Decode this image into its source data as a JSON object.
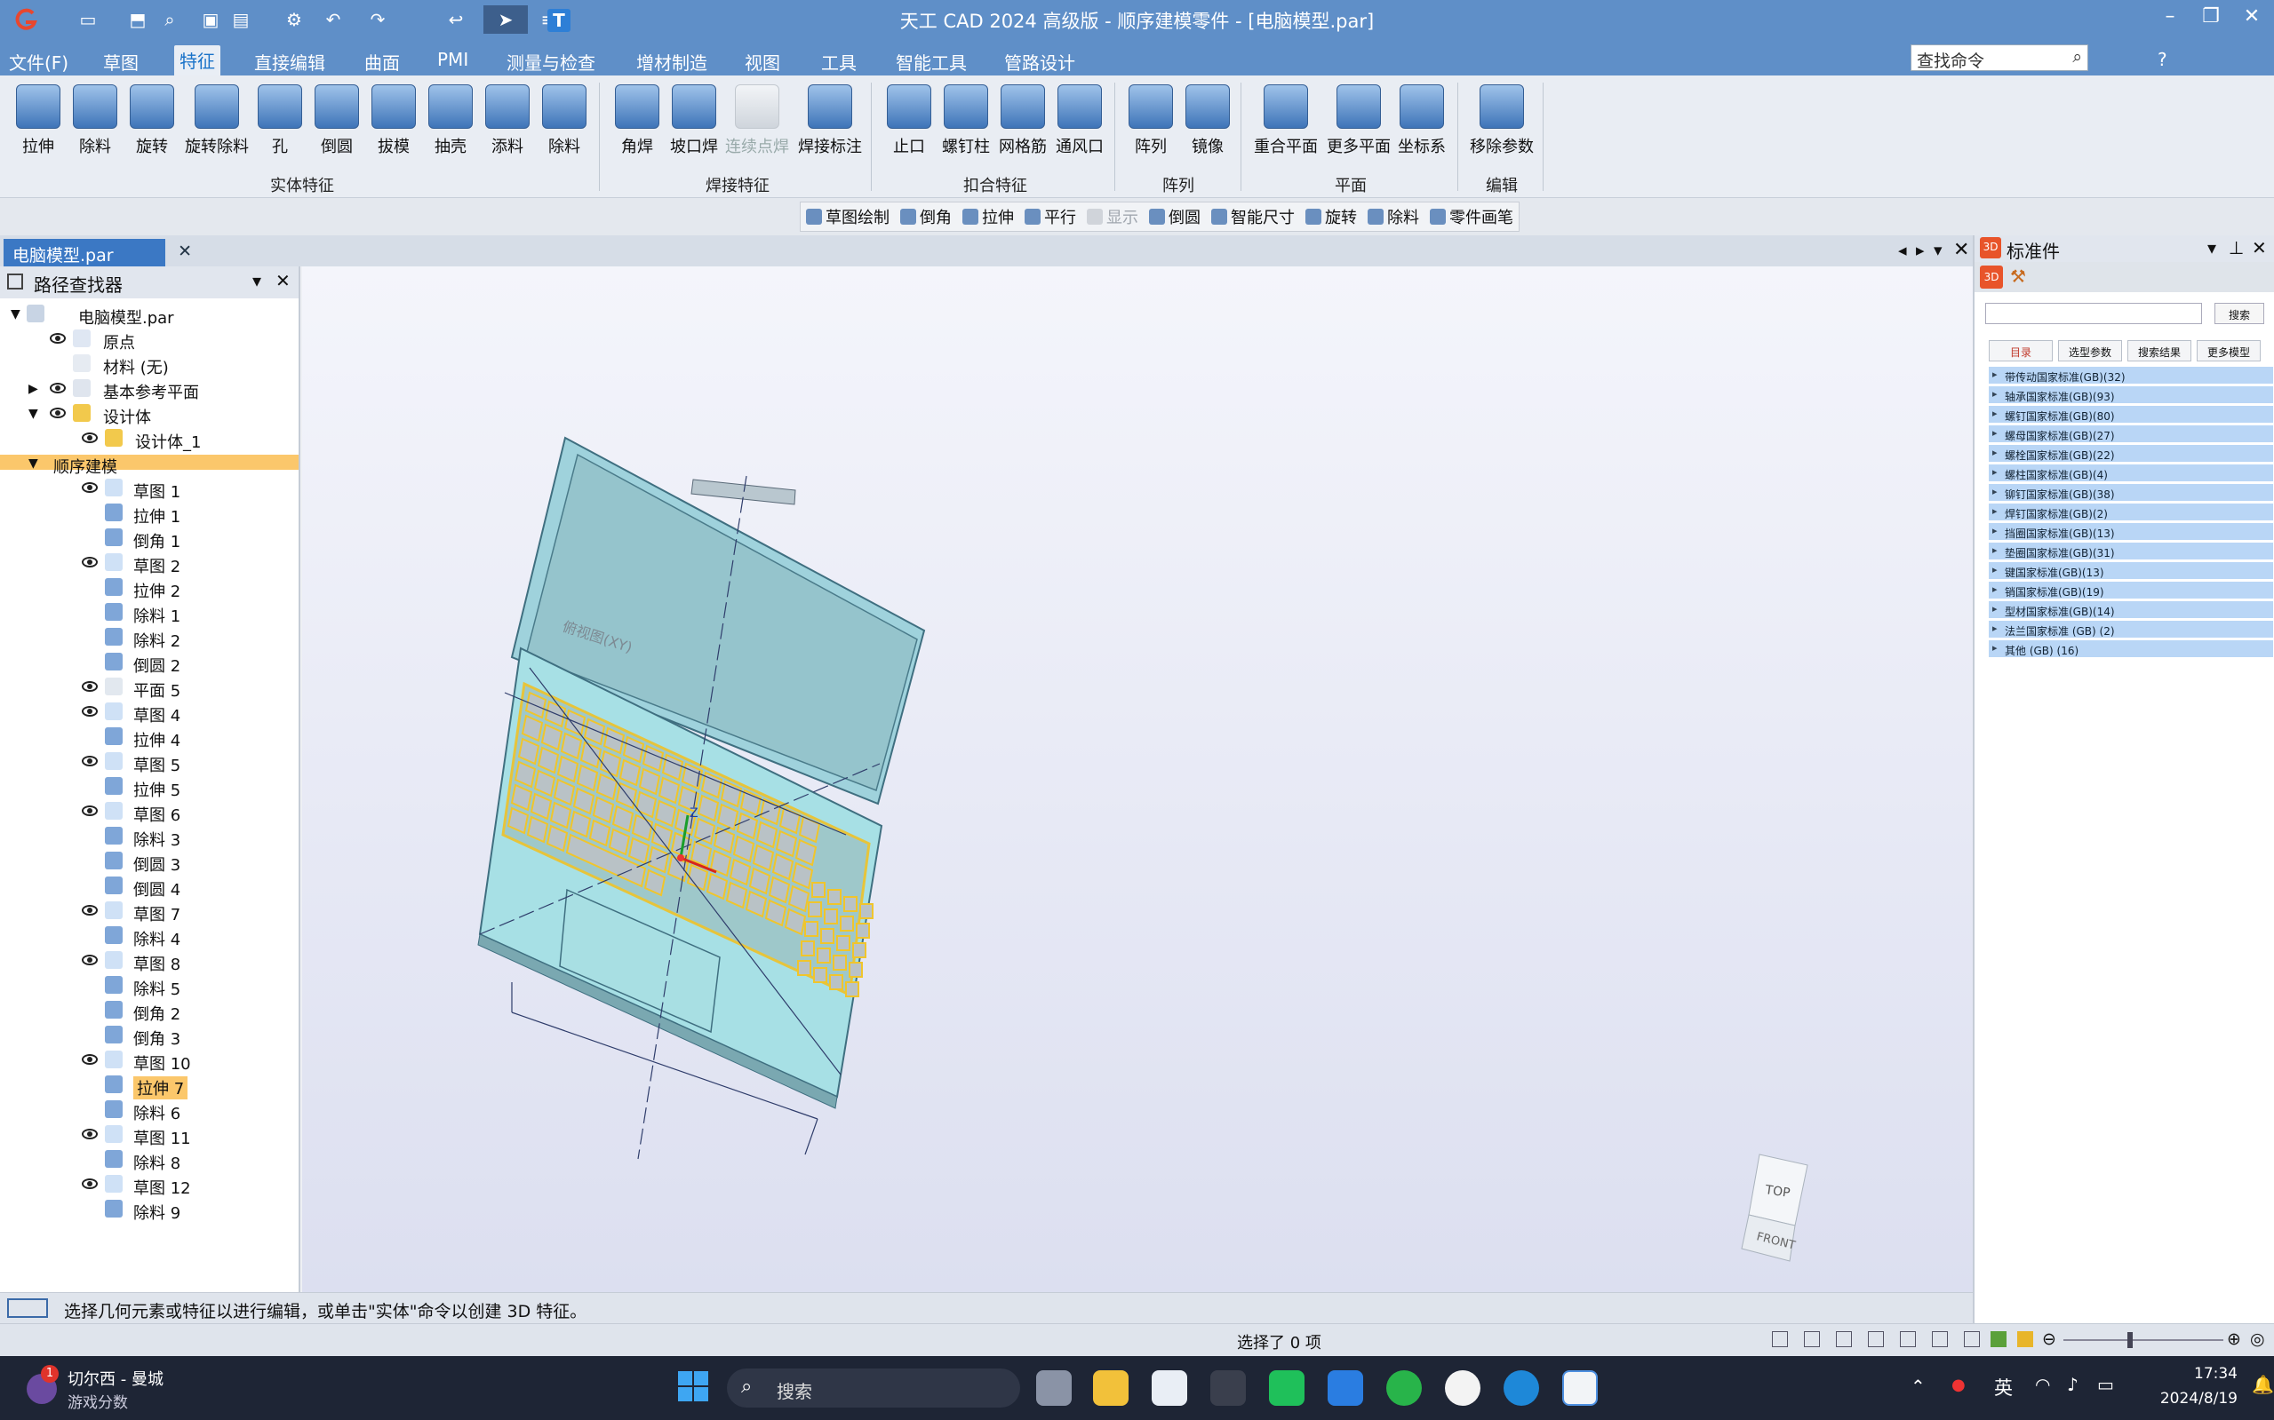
{
  "titlebar": {
    "title": "天工 CAD 2024 高级版 - 顺序建模零件 - [电脑模型.par]"
  },
  "menu": {
    "items": [
      "文件(F)",
      "草图",
      "特征",
      "直接编辑",
      "曲面",
      "PMI",
      "测量与检查",
      "增材制造",
      "视图",
      "工具",
      "智能工具",
      "管路设计"
    ],
    "active": "特征",
    "search_placeholder": "查找命令"
  },
  "ribbon": {
    "solid": {
      "buttons": [
        "拉伸",
        "除料",
        "旋转",
        "旋转除料",
        "孔",
        "倒圆",
        "拔模",
        "抽壳",
        "添料",
        "除料"
      ],
      "label": "实体特征"
    },
    "weld": {
      "buttons": [
        "角焊",
        "坡口焊",
        "连续点焊",
        "焊接标注"
      ],
      "label": "焊接特征"
    },
    "snap": {
      "buttons": [
        "止口",
        "螺钉柱",
        "网格筋",
        "通风口"
      ],
      "label": "扣合特征"
    },
    "array": {
      "buttons": [
        "阵列",
        "镜像"
      ],
      "label": "阵列"
    },
    "plane": {
      "buttons": [
        "重合平面",
        "更多平面",
        "坐标系"
      ],
      "label": "平面"
    },
    "edit": {
      "buttons": [
        "移除参数"
      ],
      "label": "编辑"
    }
  },
  "subtoolbar": [
    "草图绘制",
    "倒角",
    "拉伸",
    "平行",
    "显示",
    "倒圆",
    "智能尺寸",
    "旋转",
    "除料",
    "零件画笔"
  ],
  "doc_tab": "电脑模型.par",
  "pathfinder": {
    "title": "路径查找器",
    "root": "电脑模型.par",
    "top": [
      "原点",
      "材料 (无)",
      "基本参考平面",
      "设计体",
      "设计体_1",
      "顺序建模"
    ],
    "features": [
      "草图 1",
      "拉伸 1",
      "倒角 1",
      "草图 2",
      "拉伸 2",
      "除料 1",
      "除料 2",
      "倒圆 2",
      "平面 5",
      "草图 4",
      "拉伸 4",
      "草图 5",
      "拉伸 5",
      "草图 6",
      "除料 3",
      "倒圆 3",
      "倒圆 4",
      "草图 7",
      "除料 4",
      "草图 8",
      "除料 5",
      "倒角 2",
      "倒角 3",
      "草图 10",
      "拉伸 7",
      "除料 6",
      "草图 11",
      "除料 8",
      "草图 12",
      "除料 9"
    ]
  },
  "viewport": {
    "view_cube_top": "TOP",
    "view_cube_front": "FRONT",
    "plane_label": "俯视图(XY)"
  },
  "standard_parts": {
    "title": "标准件",
    "search_button": "搜索",
    "tabs": [
      "目录",
      "选型参数",
      "搜索结果",
      "更多模型"
    ],
    "rows": [
      "带传动国家标准(GB)(32)",
      "轴承国家标准(GB)(93)",
      "螺钉国家标准(GB)(80)",
      "螺母国家标准(GB)(27)",
      "螺栓国家标准(GB)(22)",
      "螺柱国家标准(GB)(4)",
      "铆钉国家标准(GB)(38)",
      "焊钉国家标准(GB)(2)",
      "挡圈国家标准(GB)(13)",
      "垫圈国家标准(GB)(31)",
      "键国家标准(GB)(13)",
      "销国家标准(GB)(19)",
      "型材国家标准(GB)(14)",
      "法兰国家标准 (GB) (2)",
      "其他 (GB) (16)"
    ]
  },
  "status": {
    "prompt": "选择几何元素或特征以进行编辑，或单击\"实体\"命令以创建 3D 特征。",
    "selected": "选择了 0 项"
  },
  "taskbar": {
    "music_title": "切尔西 - 曼城",
    "music_sub": "游戏分数",
    "badge": "1",
    "search": "搜索",
    "ime": "英",
    "time": "17:34",
    "date": "2024/8/19"
  }
}
